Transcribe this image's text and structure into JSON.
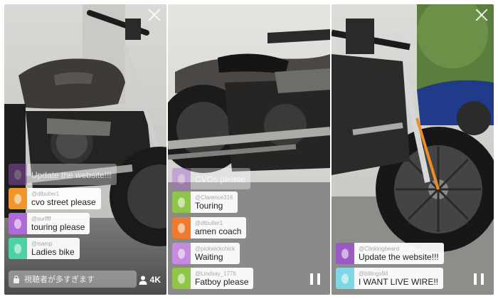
{
  "colors": {
    "orange": "#f0962a",
    "purple": "#b06ad6",
    "teal": "#4fd1a8",
    "red_orange": "#f07a2e",
    "lavender": "#c68be0",
    "green": "#8fc64a",
    "violet": "#9b59c4",
    "aqua": "#7dd8e3"
  },
  "panels": [
    {
      "comments": [
        {
          "user": "",
          "message": "Update the website!!!",
          "avatar_color": "#9b59c4",
          "faded": true
        },
        {
          "user": "@dtbutler1",
          "message": "cvo street please",
          "avatar_color": "#f0962a"
        },
        {
          "user": "@surffff",
          "message": "touring please",
          "avatar_color": "#b06ad6"
        },
        {
          "user": "@isamp",
          "message": "Ladies bike",
          "avatar_color": "#4fd1a8"
        }
      ],
      "chat_placeholder": "視聴者が多すぎます",
      "viewer_count": "4K"
    },
    {
      "comments": [
        {
          "user": "",
          "message": "CVOs please",
          "avatar_color": "#b06ad6",
          "faded": true
        },
        {
          "user": "@Clarence316",
          "message": "Touring",
          "avatar_color": "#8fc64a"
        },
        {
          "user": "@dtbutler1",
          "message": "amen coach",
          "avatar_color": "#f07a2e"
        },
        {
          "user": "@pickwickchick",
          "message": "Waiting",
          "avatar_color": "#c68be0"
        },
        {
          "user": "@Lindsay_1776",
          "message": "Fatboy please",
          "avatar_color": "#8fc64a"
        }
      ]
    },
    {
      "comments": [
        {
          "user": "@Clinkingbeard",
          "message": "Update the website!!!",
          "avatar_color": "#9b59c4"
        },
        {
          "user": "@billings94",
          "message": "I WANT LIVE WIRE!!",
          "avatar_color": "#7dd8e3"
        }
      ]
    }
  ]
}
